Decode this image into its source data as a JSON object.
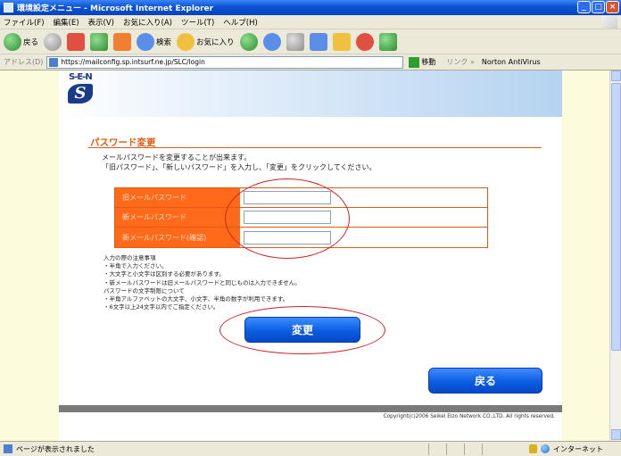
{
  "window": {
    "title": "環境設定メニュー - Microsoft Internet Explorer"
  },
  "menu": [
    "ファイル(F)",
    "編集(E)",
    "表示(V)",
    "お気に入り(A)",
    "ツール(T)",
    "ヘルプ(H)"
  ],
  "toolbar": {
    "back": "戻る",
    "search": "検索",
    "favorites": "お気に入り"
  },
  "address": {
    "label": "アドレス(D)",
    "url": "https://mailconfig.sp.intsurf.ne.jp/SLC/login",
    "go": "移動",
    "links": "リンク »",
    "norton": "Norton AntiVirus"
  },
  "logo": {
    "text": "S-E-N"
  },
  "section": {
    "title": "パスワード変更"
  },
  "intro": {
    "line1": "メールパスワードを変更することが出来ます。",
    "line2": "「旧パスワード」、「新しいパスワード」を入力し、「変更」をクリックしてください。"
  },
  "form": {
    "old_label": "旧メールパスワード",
    "new_label": "新メールパスワード",
    "confirm_label": "新メールパスワード(確認)"
  },
  "notes": [
    "入力の際の注意事項",
    "・半角で入力ください。",
    "・大文字と小文字は区別する必要があります。",
    "・新メールパスワードは旧メールパスワードと同じものは入力できません。",
    "パスワードの文字制限について",
    "・半角アルファベットの大文字、小文字、半角の数字が利用できます。",
    "・6文字以上24文字以内でご指定ください。"
  ],
  "buttons": {
    "change": "変更",
    "back": "戻る"
  },
  "footer": {
    "copyright": "Copyright(c)2006 Seikei Eizo Network CO.,LTD. All rights reserved."
  },
  "status": {
    "text": "ページが表示されました",
    "zone": "インターネット"
  },
  "colors": {
    "accent": "#ff6a1a",
    "button": "#0c5de0",
    "annotation": "#d42020"
  }
}
